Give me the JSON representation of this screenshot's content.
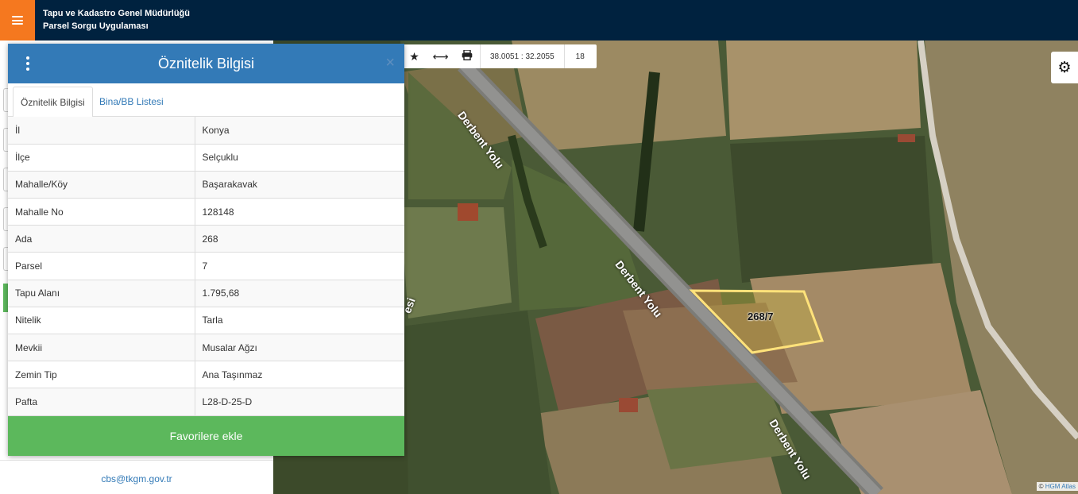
{
  "header": {
    "title_line1": "Tapu ve Kadastro Genel Müdürlüğü",
    "title_line2": "Parsel Sorgu Uygulaması"
  },
  "toolbar": {
    "coordinates": "38.0051 : 32.2055",
    "zoom": "18"
  },
  "map": {
    "road_label_top": "Derbent Yolu",
    "road_label_mid": "Derbent Yolu",
    "road_label_bottom": "Derbent Yolu",
    "parcel_label": "268/7",
    "partial_label": "esi",
    "attribution_prefix": "©",
    "attribution_link": "HGM Atlas",
    "parcel_color": "#ffe27a"
  },
  "popup": {
    "title": "Öznitelik Bilgisi",
    "close_glyph": "×",
    "tabs": [
      {
        "label": "Öznitelik Bilgisi",
        "active": true
      },
      {
        "label": "Bina/BB Listesi",
        "active": false
      }
    ],
    "rows": [
      {
        "key": "İl",
        "value": "Konya"
      },
      {
        "key": "İlçe",
        "value": "Selçuklu"
      },
      {
        "key": "Mahalle/Köy",
        "value": "Başarakavak"
      },
      {
        "key": "Mahalle No",
        "value": "128148"
      },
      {
        "key": "Ada",
        "value": "268"
      },
      {
        "key": "Parsel",
        "value": "7"
      },
      {
        "key": "Tapu Alanı",
        "value": "1.795,68"
      },
      {
        "key": "Nitelik",
        "value": "Tarla"
      },
      {
        "key": "Mevkii",
        "value": "Musalar Ağzı"
      },
      {
        "key": "Zemin Tip",
        "value": "Ana Taşınmaz"
      },
      {
        "key": "Pafta",
        "value": "L28-D-25-D"
      }
    ],
    "favorite_label": "Favorilere ekle"
  },
  "sidebar": {
    "email": "cbs@tkgm.gov.tr"
  },
  "colors": {
    "header_bg": "#00223f",
    "menu_accent": "#f5781f",
    "popup_header": "#337ab7",
    "button_green": "#5cb85c"
  }
}
